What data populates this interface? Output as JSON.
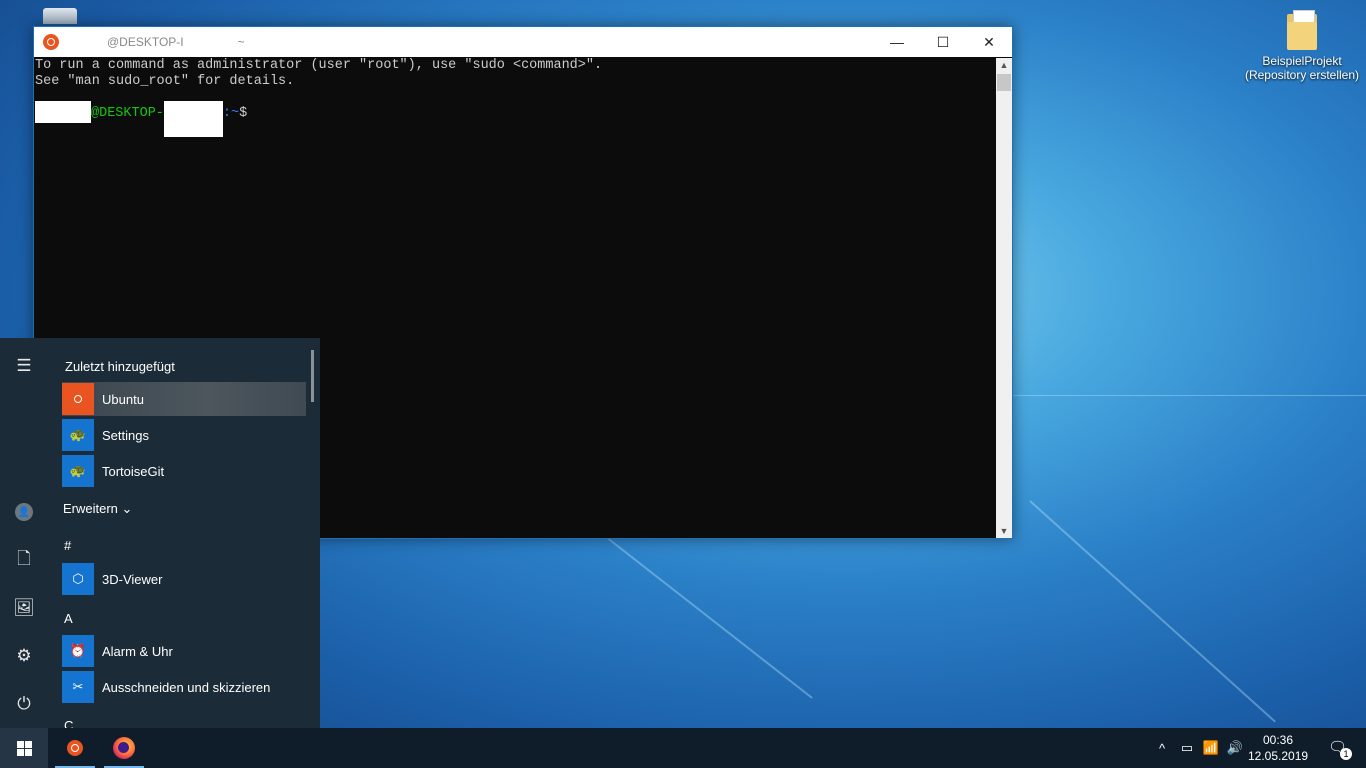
{
  "desktop": {
    "icons": [
      {
        "name": "recycle-bin",
        "label": ""
      },
      {
        "name": "folder",
        "label_line1": "BeispielProjekt",
        "label_line2": "(Repository erstellen)"
      }
    ]
  },
  "terminal": {
    "title_host": "@DESKTOP-I",
    "title_path": "~",
    "controls": {
      "minimize": "—",
      "maximize": "☐",
      "close": "✕"
    },
    "lines": [
      "To run a command as administrator (user \"root\"), use \"sudo <command>\".",
      "See \"man sudo_root\" for details."
    ],
    "prompt": {
      "host": "@DESKTOP-",
      "path": ":~",
      "symbol": "$"
    }
  },
  "start_menu": {
    "recent_header": "Zuletzt hinzugefügt",
    "recent_apps": [
      {
        "label": "Ubuntu",
        "icon": "ubuntu-icon",
        "selected": true
      },
      {
        "label": "Settings",
        "icon": "tortoise-icon"
      },
      {
        "label": "TortoiseGit",
        "icon": "tortoise-icon"
      }
    ],
    "expand_label": "Erweitern",
    "sections": [
      {
        "letter": "#",
        "apps": [
          {
            "label": "3D-Viewer",
            "icon": "cube-icon"
          }
        ]
      },
      {
        "letter": "A",
        "apps": [
          {
            "label": "Alarm & Uhr",
            "icon": "alarm-clock-icon"
          },
          {
            "label": "Ausschneiden und skizzieren",
            "icon": "snip-sketch-icon"
          }
        ]
      },
      {
        "letter": "C",
        "apps": []
      }
    ],
    "rail": [
      "hamburger-icon",
      "user-avatar",
      "documents-icon",
      "pictures-icon",
      "settings-gear-icon",
      "power-icon"
    ]
  },
  "taskbar": {
    "pinned": [
      "ubuntu-icon",
      "firefox-icon"
    ],
    "tray": {
      "chevron": "^",
      "battery": "battery-icon",
      "wifi": "wifi-icon",
      "volume": "volume-icon"
    },
    "time": "00:36",
    "date": "12.05.2019",
    "notifications_count": "1"
  }
}
